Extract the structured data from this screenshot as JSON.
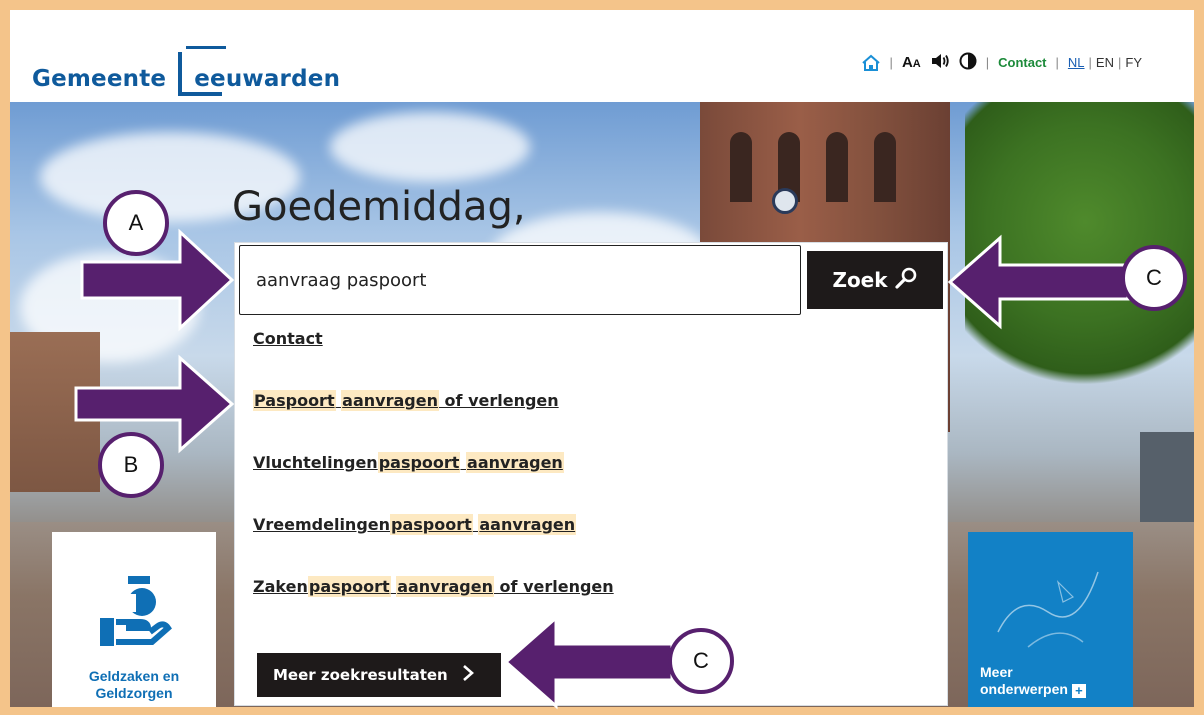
{
  "header": {
    "logo_part1": "Gemeente",
    "logo_part2": "eeuwarden",
    "fontsize_label": "A",
    "fontsize_small": "A",
    "contact": "Contact",
    "lang_nl": "NL",
    "lang_en": "EN",
    "lang_fy": "FY"
  },
  "hero": {
    "greeting": "Goedemiddag,"
  },
  "search": {
    "value": "aanvraag paspoort",
    "button_label": "Zoek",
    "suggestions": [
      {
        "parts": [
          {
            "t": "Contact",
            "hl": false
          }
        ]
      },
      {
        "parts": [
          {
            "t": "Paspoort",
            "hl": true
          },
          {
            "t": " ",
            "hl": false
          },
          {
            "t": "aanvragen",
            "hl": true
          },
          {
            "t": " of verlengen",
            "hl": false
          }
        ]
      },
      {
        "parts": [
          {
            "t": "Vluchtelingen",
            "hl": false
          },
          {
            "t": "paspoort",
            "hl": true
          },
          {
            "t": " ",
            "hl": false
          },
          {
            "t": "aanvragen",
            "hl": true
          }
        ]
      },
      {
        "parts": [
          {
            "t": "Vreemdelingen",
            "hl": false
          },
          {
            "t": "paspoort",
            "hl": true
          },
          {
            "t": " ",
            "hl": false
          },
          {
            "t": "aanvragen",
            "hl": true
          }
        ]
      },
      {
        "parts": [
          {
            "t": "Zaken",
            "hl": false
          },
          {
            "t": "paspoort",
            "hl": true
          },
          {
            "t": " ",
            "hl": false
          },
          {
            "t": "aanvragen",
            "hl": true
          },
          {
            "t": " of verlengen",
            "hl": false
          }
        ]
      }
    ],
    "more_label": "Meer zoekresultaten"
  },
  "tiles": {
    "left_label_1": "Geldzaken en",
    "left_label_2": "Geldzorgen",
    "right_label_1": "Meer",
    "right_label_2": "onderwerpen"
  },
  "annotations": {
    "a": "A",
    "b": "B",
    "c1": "C",
    "c2": "C"
  },
  "colors": {
    "brand_blue": "#0f5a9c",
    "highlight": "#fde9c2",
    "arrow_purple": "#57206e",
    "frame": "#f4c48a"
  },
  "icons": [
    "home-icon",
    "speaker-icon",
    "contrast-icon",
    "search-icon",
    "chevron-right-icon",
    "money-hand-icon",
    "plus-icon"
  ]
}
